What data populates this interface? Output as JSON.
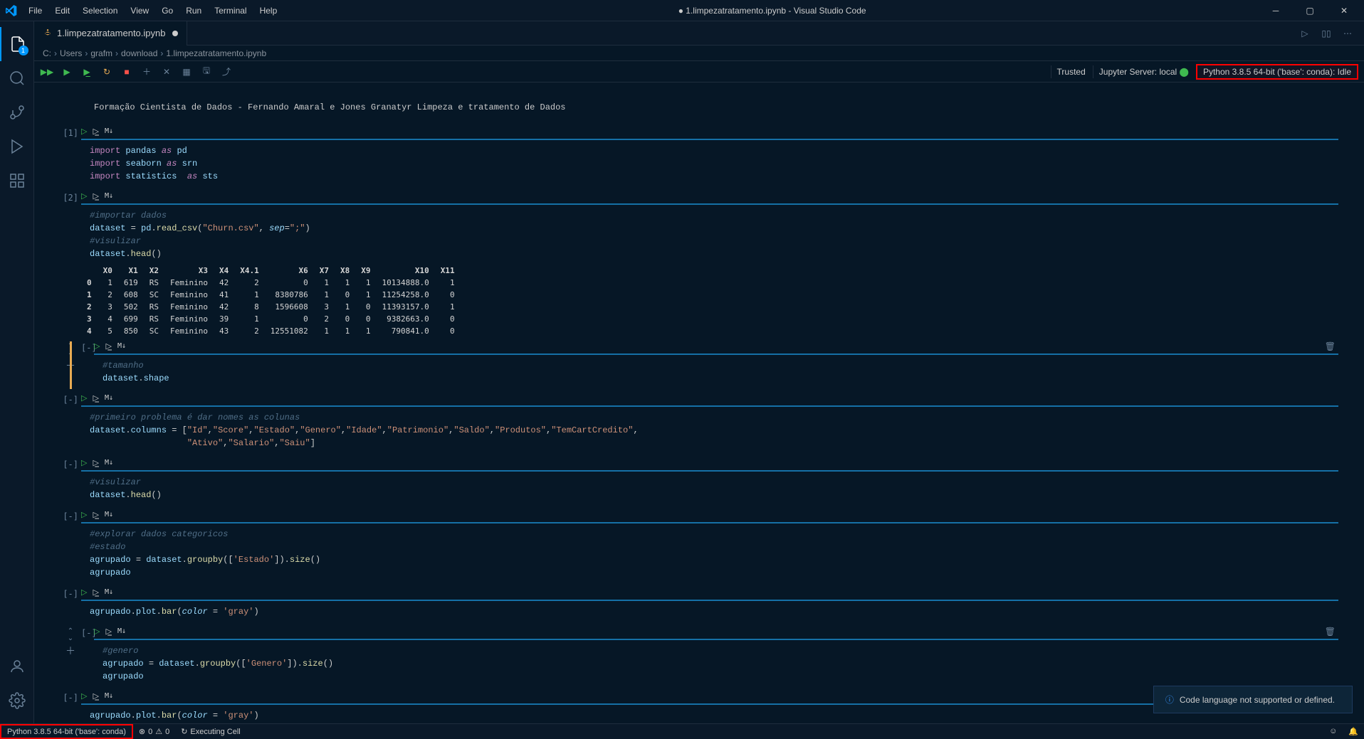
{
  "titlebar": {
    "title": "● 1.limpezatratamento.ipynb - Visual Studio Code"
  },
  "menu": {
    "file": "File",
    "edit": "Edit",
    "selection": "Selection",
    "view": "View",
    "go": "Go",
    "run": "Run",
    "terminal": "Terminal",
    "help": "Help"
  },
  "tab": {
    "label": "1.limpezatratamento.ipynb"
  },
  "breadcrumbs": {
    "seg0": "C:",
    "seg1": "Users",
    "seg2": "grafm",
    "seg3": "download",
    "seg4": "1.limpezatratamento.ipynb"
  },
  "nb_toolbar": {
    "trusted": "Trusted",
    "jupyter": "Jupyter Server: local",
    "kernel": "Python 3.8.5 64-bit ('base': conda): Idle"
  },
  "markdown": {
    "text": "Formação Cientista de Dados - Fernando Amaral e Jones Granatyr Limpeza e tratamento de Dados"
  },
  "cells": {
    "c1": {
      "count": "[1]",
      "lang": "M↓"
    },
    "c2": {
      "count": "[2]",
      "lang": "M↓"
    },
    "c3": {
      "count": "[-]",
      "lang": "M↓"
    },
    "c4": {
      "count": "[-]",
      "lang": "M↓"
    },
    "c5": {
      "count": "[-]",
      "lang": "M↓"
    },
    "c6": {
      "count": "[-]",
      "lang": "M↓"
    },
    "c7": {
      "count": "[-]",
      "lang": "M↓"
    },
    "c8": {
      "count": "[-]",
      "lang": "M↓"
    },
    "c9": {
      "count": "[-]",
      "lang": "M↓"
    }
  },
  "output_table": {
    "headers": [
      "",
      "X0",
      "X1",
      "X2",
      "X3",
      "X4",
      "X4.1",
      "X6",
      "X7",
      "X8",
      "X9",
      "X10",
      "X11"
    ],
    "rows": [
      [
        "0",
        "1",
        "619",
        "RS",
        "Feminino",
        "42",
        "2",
        "0",
        "1",
        "1",
        "1",
        "10134888.0",
        "1"
      ],
      [
        "1",
        "2",
        "608",
        "SC",
        "Feminino",
        "41",
        "1",
        "8380786",
        "1",
        "0",
        "1",
        "11254258.0",
        "0"
      ],
      [
        "2",
        "3",
        "502",
        "RS",
        "Feminino",
        "42",
        "8",
        "1596608",
        "3",
        "1",
        "0",
        "11393157.0",
        "1"
      ],
      [
        "3",
        "4",
        "699",
        "RS",
        "Feminino",
        "39",
        "1",
        "0",
        "2",
        "0",
        "0",
        "9382663.0",
        "0"
      ],
      [
        "4",
        "5",
        "850",
        "SC",
        "Feminino",
        "43",
        "2",
        "12551082",
        "1",
        "1",
        "1",
        "790841.0",
        "0"
      ]
    ]
  },
  "notification": {
    "text": "Code language not supported or defined."
  },
  "statusbar": {
    "kernel": "Python 3.8.5 64-bit ('base': conda)",
    "errors": "0",
    "warnings": "0",
    "executing": "Executing Cell"
  },
  "activity_badge": "1"
}
